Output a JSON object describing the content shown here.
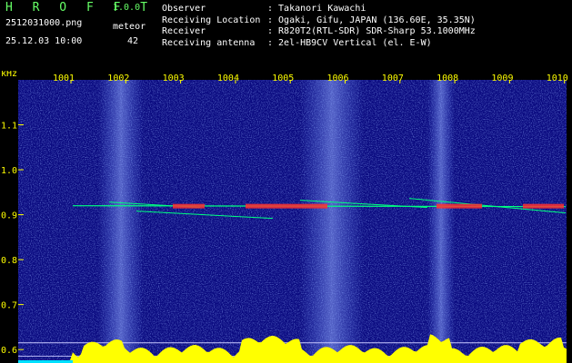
{
  "app": {
    "name": "H R O F F T",
    "version": "1.0.0"
  },
  "file": {
    "name": "2512031000.png",
    "datetime": "25.12.03 10:00"
  },
  "meteor": {
    "label": "meteor",
    "count": "42"
  },
  "info": [
    {
      "key": "Observer",
      "value": ": Takanori Kawachi"
    },
    {
      "key": "Receiving Location",
      "value": ": Ogaki, Gifu, JAPAN (136.60E, 35.35N)"
    },
    {
      "key": "Receiver",
      "value": ": R820T2(RTL-SDR) SDR-Sharp 53.1000MHz"
    },
    {
      "key": "Receiving antenna",
      "value": ": 2el-HB9CV Vertical (el. E-W)"
    }
  ],
  "chart_data": {
    "type": "heatmap",
    "ylabel": "kHz",
    "x_ticks": [
      "1001",
      "1002",
      "1003",
      "1004",
      "1005",
      "1006",
      "1007",
      "1008",
      "1009",
      "1010"
    ],
    "y_ticks": [
      "1.1",
      "1.0",
      "0.9",
      "0.8",
      "0.7",
      "0.6"
    ],
    "ylim": [
      0.57,
      1.2
    ],
    "carrier_khz": 0.92,
    "colors": {
      "background": "#0a0a80",
      "echo": "#ff3030",
      "trace": "#00ff80",
      "axis_text": "#ffff00",
      "level": "#ffff00",
      "level_low": "#00e0ff"
    }
  }
}
